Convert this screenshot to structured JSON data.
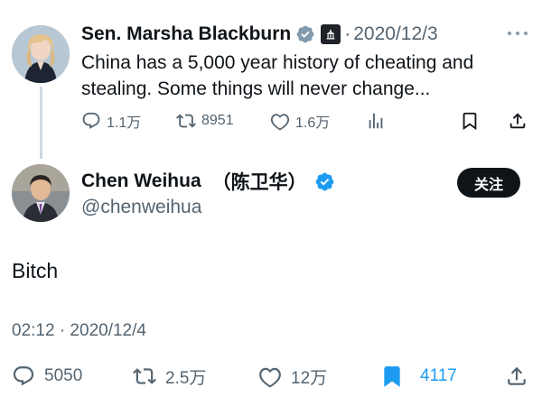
{
  "parent_tweet": {
    "author_name": "Sen. Marsha Blackburn",
    "separator": "·",
    "date": "2020/12/3",
    "text": "China has a 5,000 year history of cheating and stealing. Some things will never change...",
    "actions": {
      "replies": "1.1万",
      "retweets": "8951",
      "likes": "1.6万"
    }
  },
  "main_tweet": {
    "author_name": "Chen Weihua",
    "author_name_cn": "（陈卫华）",
    "handle": "@chenweihua",
    "follow_label": "关注",
    "text": "Bitch",
    "timestamp": "02:12 · 2020/12/4",
    "actions": {
      "replies": "5050",
      "retweets": "2.5万",
      "likes": "12万",
      "bookmarks": "4117"
    }
  },
  "colors": {
    "text_primary": "#0f1419",
    "text_secondary": "#536471",
    "verified_blue": "#1d9bf0",
    "verified_grey": "#829aab",
    "bookmark_active": "#1d9bf0",
    "follow_button_bg": "#0f1419"
  },
  "icons": {
    "reply": "reply-icon",
    "retweet": "retweet-icon",
    "like": "heart-icon",
    "views": "analytics-icon",
    "bookmark": "bookmark-icon",
    "share": "share-icon",
    "more": "more-icon"
  }
}
